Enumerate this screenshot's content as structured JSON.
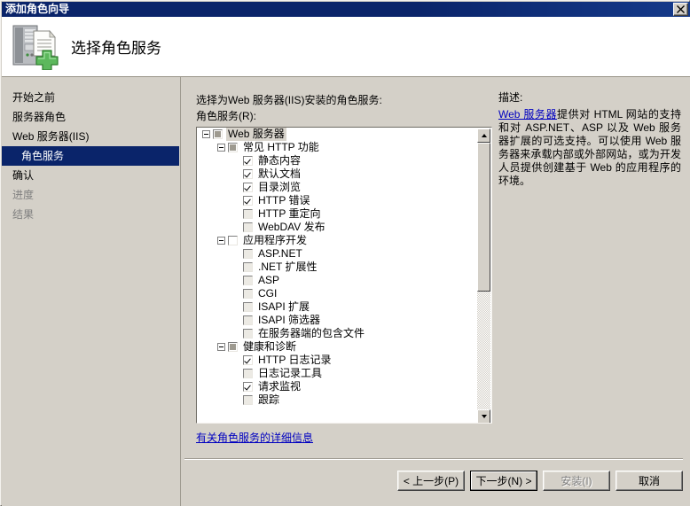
{
  "window": {
    "title": "添加角色向导",
    "close_label": "×"
  },
  "header": {
    "title": "选择角色服务",
    "icon": "server-add-icon"
  },
  "sidebar": {
    "items": [
      {
        "label": "开始之前",
        "state": "normal"
      },
      {
        "label": "服务器角色",
        "state": "normal"
      },
      {
        "label": "Web 服务器(IIS)",
        "state": "normal"
      },
      {
        "label": "角色服务",
        "state": "selected"
      },
      {
        "label": "确认",
        "state": "normal"
      },
      {
        "label": "进度",
        "state": "disabled"
      },
      {
        "label": "结果",
        "state": "disabled"
      }
    ]
  },
  "main": {
    "instruction": "选择为Web 服务器(IIS)安装的角色服务:",
    "role_services_label": "角色服务(R):",
    "more_info_link": "有关角色服务的详细信息",
    "tree": [
      {
        "label": "Web 服务器",
        "level": 1,
        "expander": "minus",
        "check": "partial",
        "selected": true
      },
      {
        "label": "常见 HTTP 功能",
        "level": 2,
        "expander": "minus",
        "check": "partial",
        "selected": false
      },
      {
        "label": "静态内容",
        "level": 3,
        "expander": "none",
        "check": "checked",
        "selected": false
      },
      {
        "label": "默认文档",
        "level": 3,
        "expander": "none",
        "check": "checked",
        "selected": false
      },
      {
        "label": "目录浏览",
        "level": 3,
        "expander": "none",
        "check": "checked",
        "selected": false
      },
      {
        "label": "HTTP 错误",
        "level": 3,
        "expander": "none",
        "check": "checked",
        "selected": false
      },
      {
        "label": "HTTP 重定向",
        "level": 3,
        "expander": "none",
        "check": "dim",
        "selected": false
      },
      {
        "label": "WebDAV 发布",
        "level": 3,
        "expander": "none",
        "check": "dim",
        "selected": false
      },
      {
        "label": "应用程序开发",
        "level": 2,
        "expander": "minus",
        "check": "empty",
        "selected": false
      },
      {
        "label": "ASP.NET",
        "level": 3,
        "expander": "none",
        "check": "dim",
        "selected": false
      },
      {
        "label": ".NET 扩展性",
        "level": 3,
        "expander": "none",
        "check": "dim",
        "selected": false
      },
      {
        "label": "ASP",
        "level": 3,
        "expander": "none",
        "check": "dim",
        "selected": false
      },
      {
        "label": "CGI",
        "level": 3,
        "expander": "none",
        "check": "dim",
        "selected": false
      },
      {
        "label": "ISAPI 扩展",
        "level": 3,
        "expander": "none",
        "check": "dim",
        "selected": false
      },
      {
        "label": "ISAPI 筛选器",
        "level": 3,
        "expander": "none",
        "check": "dim",
        "selected": false
      },
      {
        "label": "在服务器端的包含文件",
        "level": 3,
        "expander": "none",
        "check": "dim",
        "selected": false
      },
      {
        "label": "健康和诊断",
        "level": 2,
        "expander": "minus",
        "check": "partial",
        "selected": false
      },
      {
        "label": "HTTP 日志记录",
        "level": 3,
        "expander": "none",
        "check": "checked",
        "selected": false
      },
      {
        "label": "日志记录工具",
        "level": 3,
        "expander": "none",
        "check": "dim",
        "selected": false
      },
      {
        "label": "请求监视",
        "level": 3,
        "expander": "none",
        "check": "checked",
        "selected": false
      },
      {
        "label": "跟踪",
        "level": 3,
        "expander": "none",
        "check": "dim",
        "selected": false
      }
    ]
  },
  "description": {
    "title": "描述:",
    "link_text": "Web 服务器",
    "body": "提供对 HTML 网站的支持和对 ASP.NET、ASP 以及 Web 服务器扩展的可选支持。可以使用 Web 服务器来承载内部或外部网站，或为开发人员提供创建基于 Web 的应用程序的环境。"
  },
  "footer": {
    "buttons": [
      {
        "label": "< 上一步(P)",
        "state": "normal"
      },
      {
        "label": "下一步(N) >",
        "state": "default"
      },
      {
        "label": "安装(I)",
        "state": "disabled"
      },
      {
        "label": "取消",
        "state": "normal"
      }
    ]
  },
  "colors": {
    "titlebar": "#0a246a",
    "face": "#d4d0c8",
    "link": "#0000c0",
    "highlight": "#0a246a"
  }
}
